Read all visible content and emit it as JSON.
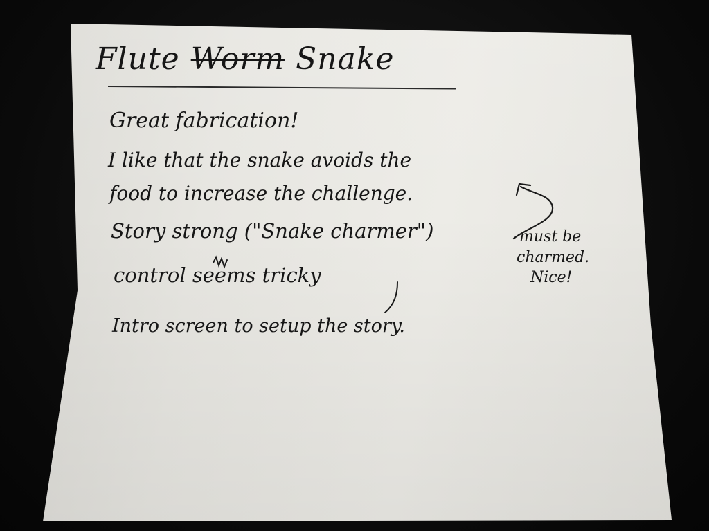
{
  "note": {
    "title": {
      "word_1": "Flute",
      "struck_word": "Worm",
      "word_2": "Snake"
    },
    "lines": [
      "Great fabrication!",
      "I like that the snake avoids the",
      "food to increase the challenge.",
      "Story strong (\"Snake charmer\")",
      "control seems tricky",
      "Intro screen to setup the story."
    ],
    "side_note": [
      "must be",
      "charmed.",
      "Nice!"
    ]
  },
  "colors": {
    "ink": "#161616",
    "paper": "#e7e6e1",
    "background": "#0b0b0b"
  }
}
